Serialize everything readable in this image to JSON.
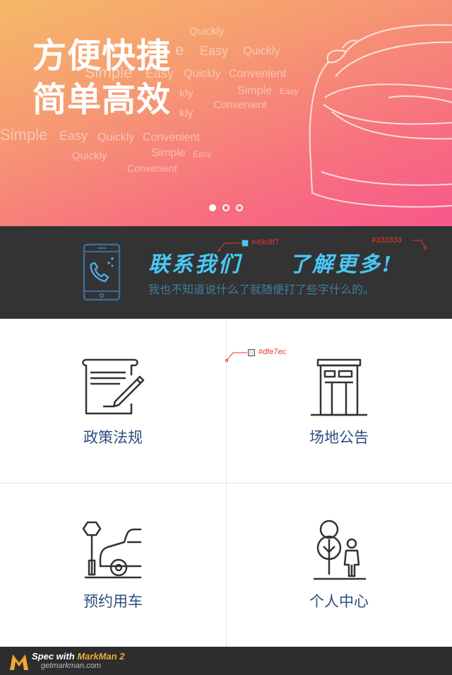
{
  "banner": {
    "headline_line1": "方便快捷",
    "headline_line2": "简单高效",
    "background_words": [
      "Quickly",
      "Easy",
      "Quickly",
      "Simple",
      "Easy",
      "Quickly",
      "Convenient",
      "Simple",
      "Easy",
      "Convenient",
      "Simple",
      "Easy",
      "Quickly",
      "Convenient",
      "Quickly",
      "Simple",
      "Easy",
      "Convenient",
      "kly",
      "e",
      "kly"
    ],
    "carousel": {
      "count": 3,
      "active_index": 0
    },
    "colors": {
      "gradient_start": "#f5b967",
      "gradient_end": "#f7588a"
    }
  },
  "contact": {
    "title_part1": "联系我们",
    "title_part2": "了解更多!",
    "subtitle": "我也不知道说什么了就随便打了些字什么的。",
    "icon": "phone-call-icon",
    "spec_color_title": "#49c8f7",
    "spec_color_bg": "#333333"
  },
  "grid": {
    "spec_color_divider": "#dfe7ec",
    "items": [
      {
        "label": "政策法规",
        "icon": "document-pen-icon"
      },
      {
        "label": "场地公告",
        "icon": "notice-kiosk-icon"
      },
      {
        "label": "预约用车",
        "icon": "car-parking-icon"
      },
      {
        "label": "个人中心",
        "icon": "person-tree-icon"
      }
    ],
    "label_color": "#2c4f80"
  },
  "footer": {
    "spec_with": "Spec with",
    "brand": "MarkMan 2",
    "url": "getmarkman.com"
  }
}
